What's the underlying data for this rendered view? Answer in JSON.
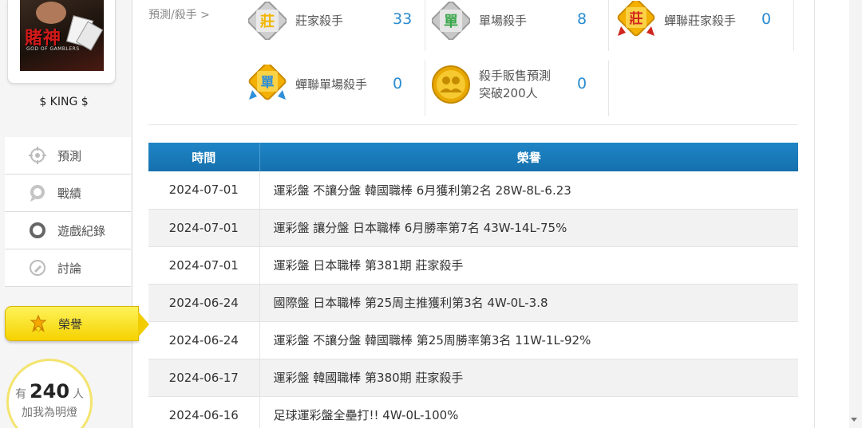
{
  "sidebar": {
    "username": "$ KING $",
    "avatar_logo_text": "賭神",
    "avatar_logo_sub": "GOD OF GAMBLERS",
    "nav": [
      {
        "label": "預測",
        "icon": "crosshair-icon"
      },
      {
        "label": "戰績",
        "icon": "record-icon"
      },
      {
        "label": "遊戲紀錄",
        "icon": "circle-icon"
      },
      {
        "label": "討論",
        "icon": "discussion-icon"
      },
      {
        "label": "榮譽",
        "icon": "medal-icon",
        "active": true
      }
    ],
    "fans": {
      "prefix": "有",
      "count": "240",
      "suffix": "人",
      "cta": "加我為明燈"
    }
  },
  "breadcrumb": "預測/殺手 >",
  "awards": [
    {
      "label": "莊家殺手",
      "count": "33",
      "badge_char": "莊",
      "icon": "banker-killer-badge-icon"
    },
    {
      "label": "單場殺手",
      "count": "8",
      "badge_char": "單",
      "icon": "single-killer-badge-icon"
    },
    {
      "label": "蟬聯莊家殺手",
      "count": "0",
      "badge_char": "莊",
      "icon": "consecutive-banker-badge-icon"
    },
    {
      "label": "蟬聯單場殺手",
      "count": "0",
      "badge_char": "單",
      "icon": "consecutive-single-badge-icon"
    },
    {
      "label_line1": "殺手販售預測",
      "label_line2": "突破200人",
      "count": "0",
      "icon": "people-gold-badge-icon"
    }
  ],
  "table": {
    "headers": [
      "時間",
      "榮譽"
    ],
    "rows": [
      {
        "date": "2024-07-01",
        "honor": "運彩盤 不讓分盤 韓國職棒 6月獲利第2名 28W-8L-6.23"
      },
      {
        "date": "2024-07-01",
        "honor": "運彩盤 讓分盤 日本職棒 6月勝率第7名 43W-14L-75%"
      },
      {
        "date": "2024-07-01",
        "honor": "運彩盤 日本職棒 第381期 莊家殺手"
      },
      {
        "date": "2024-06-24",
        "honor": "國際盤 日本職棒 第25周主推獲利第3名 4W-0L-3.8"
      },
      {
        "date": "2024-06-24",
        "honor": "運彩盤 不讓分盤 韓國職棒 第25周勝率第3名 11W-1L-92%"
      },
      {
        "date": "2024-06-17",
        "honor": "運彩盤 韓國職棒 第380期 莊家殺手"
      },
      {
        "date": "2024-06-16",
        "honor": "足球運彩盤全壘打!! 4W-0L-100%"
      }
    ]
  },
  "colors": {
    "accent_blue": "#1a78b8",
    "count_blue": "#2a8bd0",
    "active_yellow": "#f5d200"
  }
}
